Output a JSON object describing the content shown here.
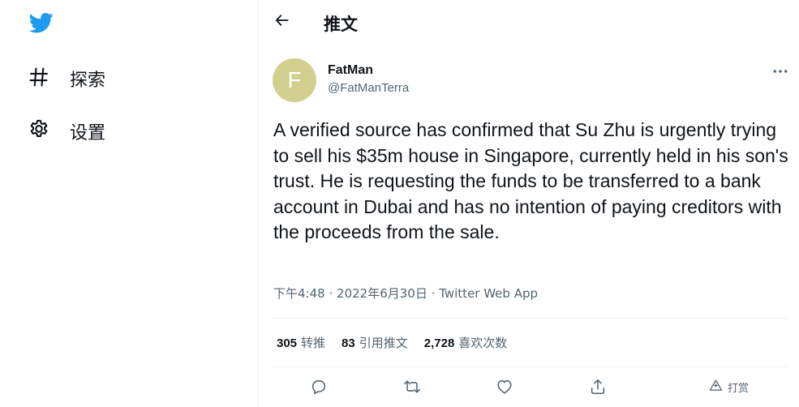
{
  "sidebar": {
    "logo_icon": "twitter-bird-icon",
    "items": [
      {
        "icon": "hashtag-icon",
        "label": "探索"
      },
      {
        "icon": "gear-icon",
        "label": "设置"
      }
    ]
  },
  "header": {
    "back_icon": "arrow-left-icon",
    "title": "推文"
  },
  "tweet": {
    "avatar_letter": "F",
    "avatar_color": "#d3cf8f",
    "author_name": "FatMan",
    "author_handle": "@FatManTerra",
    "more_icon": "more-horizontal-icon",
    "text": "A verified source has confirmed that Su Zhu is urgently trying to sell his $35m house in Singapore, currently held in his son's trust. He is requesting the funds to be transferred to a bank account in Dubai and has no intention of paying creditors with the proceeds from the sale.",
    "time": "下午4:48",
    "date": "2022年6月30日",
    "separator": "·",
    "source": "Twitter Web App",
    "stats": [
      {
        "count": "305",
        "label": "转推"
      },
      {
        "count": "83",
        "label": "引用推文"
      },
      {
        "count": "2,728",
        "label": "喜欢次数"
      }
    ],
    "actions": {
      "reply_icon": "reply-icon",
      "retweet_icon": "retweet-icon",
      "like_icon": "heart-icon",
      "share_icon": "share-icon",
      "tip_icon": "tip-icon",
      "tip_label": "打赏"
    }
  },
  "colors": {
    "accent": "#1d9bf0",
    "text_primary": "#0f1419",
    "text_secondary": "#536471",
    "border": "#eff3f4"
  }
}
